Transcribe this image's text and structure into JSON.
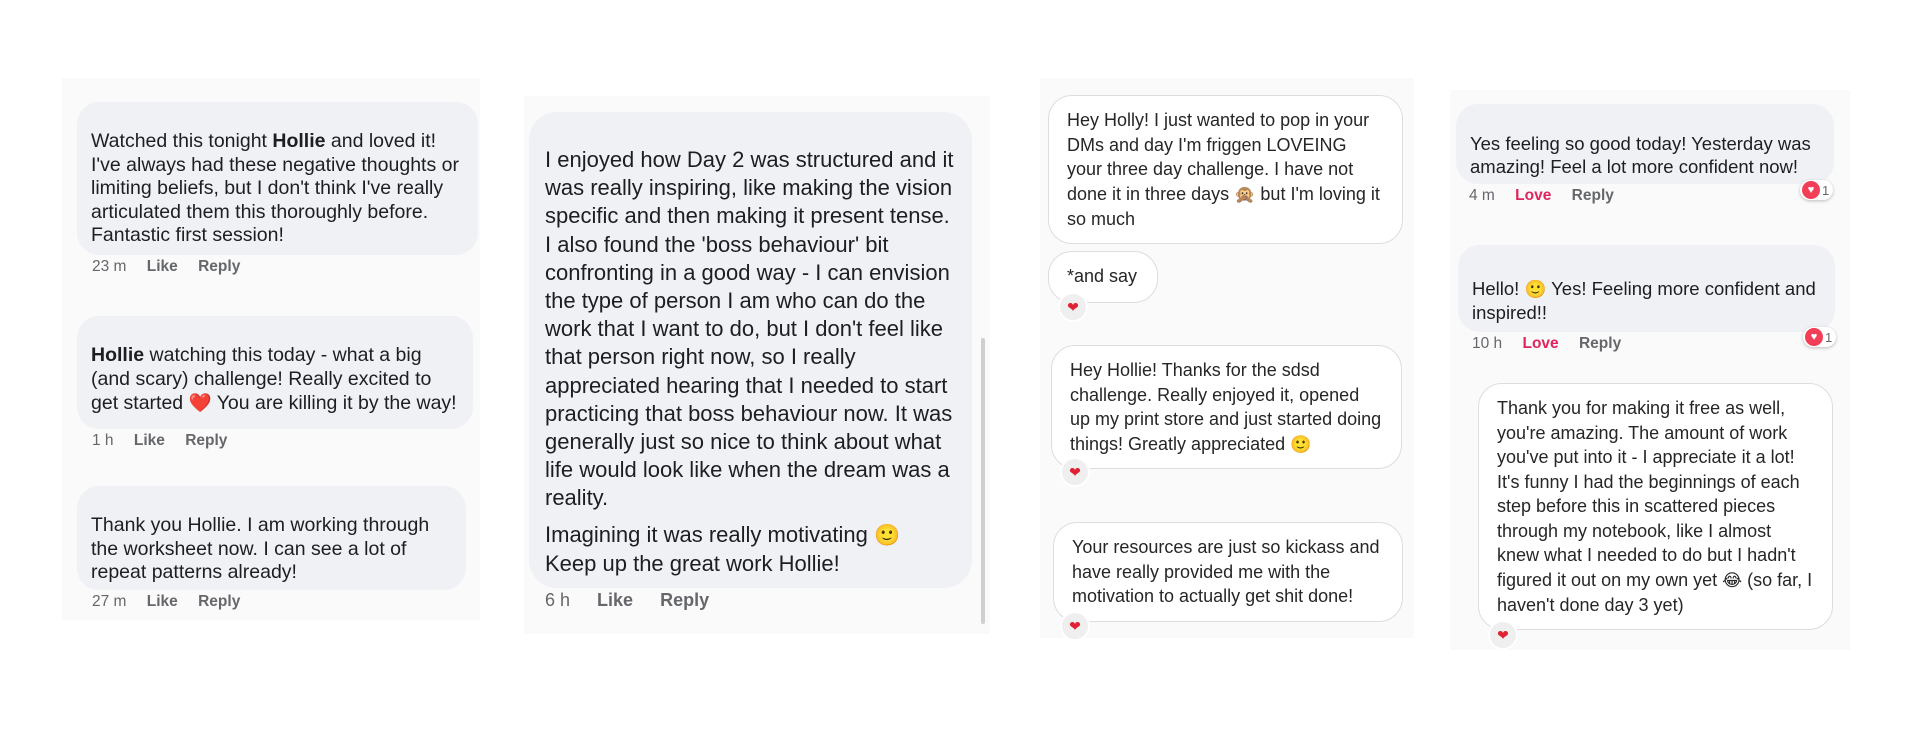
{
  "col1": {
    "comments": [
      {
        "pre": "Watched this tonight ",
        "bold": "Hollie",
        "post": " and loved it! I've always had these negative thoughts or limiting beliefs, but I don't think I've really articulated them this thoroughly before. Fantastic first session!",
        "time": "23 m",
        "like": "Like",
        "reply": "Reply"
      },
      {
        "pre": "",
        "bold": "Hollie",
        "post": " watching this today - what a big (and scary) challenge! Really excited to get started",
        "emoji": "❤️",
        "post2": " You are killing it by the way!",
        "time": "1 h",
        "like": "Like",
        "reply": "Reply"
      },
      {
        "text": "Thank you Hollie. I am working through the worksheet now. I can see a lot of repeat patterns already!",
        "time": "27 m",
        "like": "Like",
        "reply": "Reply"
      }
    ]
  },
  "col2": {
    "text": "I enjoyed how Day 2 was structured and it was really inspiring, like making the vision specific and then making it present tense. I also found the 'boss behaviour' bit confronting in a good way - I can envision the type of person I am who can do the work that I want to do, but I don't feel like that person right now, so I really appreciated hearing that I needed to start practicing that boss behaviour now. It was generally just so nice to think about what life would look like when the dream was a reality.",
    "text2": "Imagining it was really motivating",
    "emoji": "🙂",
    "text3": "Keep up the great work Hollie!",
    "time": "6 h",
    "like": "Like",
    "reply": "Reply"
  },
  "col3": {
    "messages": [
      {
        "text": "Hey Holly! I just wanted to pop in your DMs and day I'm friggen LOVEING your three day challenge. I have not done it in three days",
        "emoji": "🙊",
        "text_after": " but I'm loving it so much"
      },
      {
        "text": "*and say",
        "reaction": "❤"
      },
      {
        "text": "Hey Hollie! Thanks for the sdsd challenge. Really enjoyed it, opened up my print store and just started doing things! Greatly appreciated",
        "emoji": "🙂",
        "reaction": "❤"
      },
      {
        "text": "Your resources are just so kickass and have really provided me with the motivation to actually get shit done!",
        "reaction": "❤"
      }
    ]
  },
  "col4": {
    "comments": [
      {
        "text": "Yes feeling so good today! Yesterday was amazing! Feel a lot more confident now!",
        "time": "4 m",
        "love": "Love",
        "reply": "Reply",
        "count": "1"
      },
      {
        "text": "Hello!",
        "emoji": "🙂",
        "text_after": " Yes! Feeling more confident and inspired!!",
        "time": "10 h",
        "love": "Love",
        "reply": "Reply",
        "count": "1"
      }
    ],
    "dm": {
      "text": "Thank you for making it free as well, you're amazing. The amount of work you've put into it - I appreciate it a lot! It's funny I had the beginnings of each step before this in scattered pieces through my notebook, like I almost knew what I needed to do but I hadn't figured it out on my own yet",
      "emoji": "😂",
      "text_after": " (so far, I haven't done day 3 yet)",
      "reaction": "❤"
    }
  },
  "colors": {
    "love": "#e0245e",
    "heart": "#e02234",
    "bubble": "#f0f1f5"
  }
}
